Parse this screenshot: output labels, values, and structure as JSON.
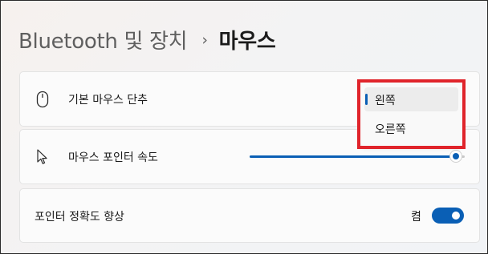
{
  "breadcrumb": {
    "parent": "Bluetooth 및 장치",
    "separator": "›",
    "current": "마우스"
  },
  "settings": {
    "primary_button": {
      "label": "기본 마우스 단추",
      "icon": "mouse-icon"
    },
    "pointer_speed": {
      "label": "마우스 포인터 속도",
      "icon": "pointer-cursor-icon",
      "value_fraction": 0.96
    },
    "pointer_precision": {
      "label": "포인터 정확도 향상",
      "toggle_text": "켬",
      "state": true
    }
  },
  "dropdown": {
    "options": [
      "왼쪽",
      "오른쪽"
    ],
    "selected": "왼쪽"
  },
  "colors": {
    "accent": "#0a5fb5",
    "highlight": "#e0242b"
  }
}
